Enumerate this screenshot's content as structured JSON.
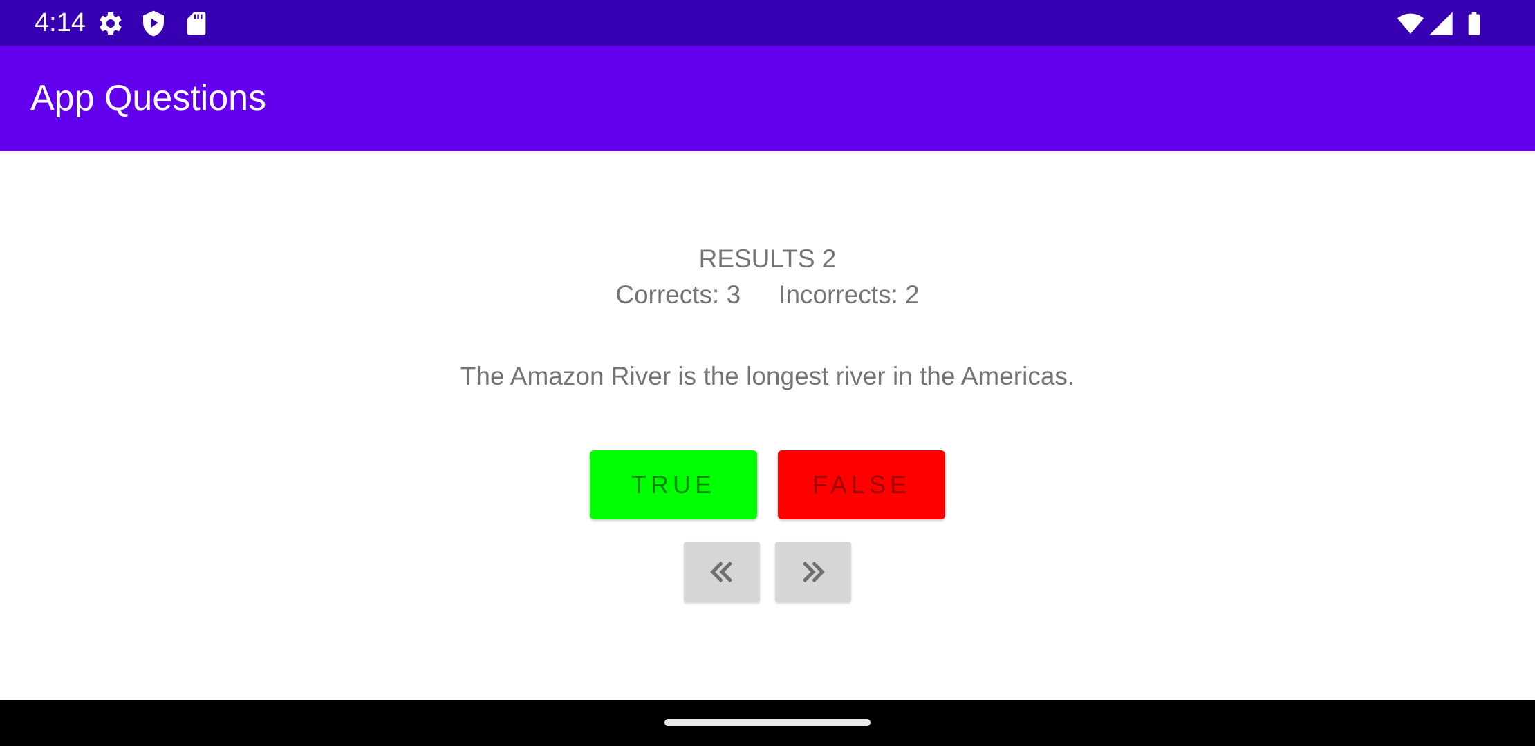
{
  "status_bar": {
    "time": "4:14",
    "left_icons": [
      "gear-icon",
      "shield-play-icon",
      "sd-card-icon"
    ],
    "right_icons": [
      "wifi-icon",
      "cell-signal-icon",
      "battery-icon"
    ],
    "background_color": "#3700b3"
  },
  "app_bar": {
    "title": "App Questions",
    "background_color": "#6200ee"
  },
  "results": {
    "title": "RESULTS 2",
    "corrects": "Corrects: 3",
    "incorrects": "Incorrects: 2"
  },
  "question": {
    "text": "The Amazon River is the longest river in the Americas."
  },
  "answers": {
    "true_label": "TRUE",
    "false_label": "FALSE",
    "true_color": "#00ff00",
    "false_color": "#ff0000"
  },
  "navigation": {
    "prev_icon": "double-chevron-left-icon",
    "next_icon": "double-chevron-right-icon"
  }
}
